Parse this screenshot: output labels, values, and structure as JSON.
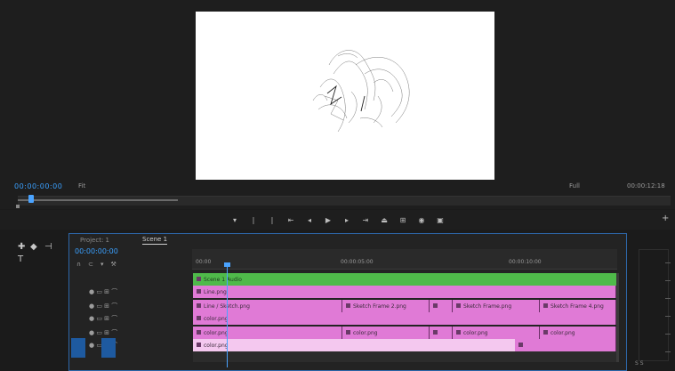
{
  "program_monitor": {
    "timecode": "00:00:00:00",
    "fit": "Fit",
    "quality": "Full",
    "end_timecode": "00:00:12:18"
  },
  "transport": {
    "buttons": [
      "marker",
      "in",
      "out",
      "step-back",
      "play-back",
      "play",
      "step-fwd",
      "go-out",
      "insert",
      "overwrite",
      "export-frame",
      "compare",
      "settings"
    ]
  },
  "timeline": {
    "tab_project": "Project: 1",
    "tab_sequence": "Scene 1",
    "timecode": "00:00:00:00",
    "ruler": [
      "00:00",
      "00:00:05:00",
      "00:00:10:00"
    ],
    "tracks": [
      {
        "name": "V4",
        "clips": [
          {
            "label": "Scene 1 Audio",
            "color": "green"
          }
        ]
      },
      {
        "name": "V3",
        "clips": [
          {
            "label": "Line.png",
            "color": "pink"
          }
        ]
      },
      {
        "name": "V2",
        "clips": [
          {
            "label": "Line / Sketch.png",
            "color": "pink"
          },
          {
            "label": "Sketch Frame 2.png",
            "color": "pink"
          },
          {
            "label": "Sketch Frame.png",
            "color": "pink"
          },
          {
            "label": "Sketch Frame 4.png",
            "color": "pink"
          }
        ]
      },
      {
        "name": "V1",
        "clips": [
          {
            "label": "color.png",
            "color": "pink"
          }
        ]
      },
      {
        "name": "A1",
        "clips": [
          {
            "label": "color.png",
            "color": "pink"
          },
          {
            "label": "color.png",
            "color": "pink"
          },
          {
            "label": "color.png",
            "color": "pink"
          },
          {
            "label": "color.png",
            "color": "pink"
          }
        ]
      },
      {
        "name": "A2",
        "clips": [
          {
            "label": "color.png",
            "color": "light"
          }
        ]
      }
    ]
  },
  "colors": {
    "accent": "#3aa0ff",
    "clip_pink": "#e07ad6",
    "clip_green": "#4fba4a",
    "clip_light": "#f4c8ef"
  }
}
